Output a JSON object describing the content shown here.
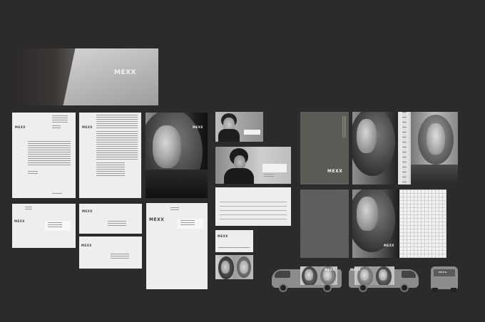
{
  "brand": {
    "logo_text": "MEXX"
  },
  "colors": {
    "background": "#2a2b2d",
    "paper": "#eeeeec",
    "brand_gray": "#5c5b56",
    "photo_dark": "#1c1c1c"
  }
}
